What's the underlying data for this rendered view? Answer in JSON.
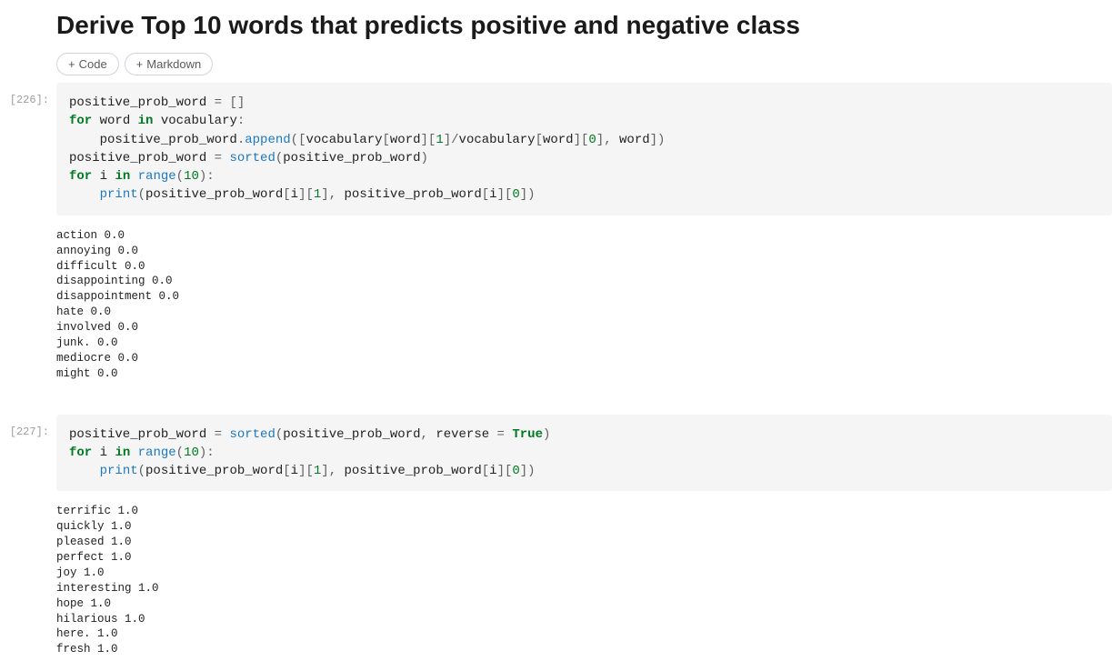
{
  "heading": "Derive Top 10 words that predicts positive and negative class",
  "toolbar": {
    "code_label": "Code",
    "markdown_label": "Markdown"
  },
  "cells": [
    {
      "prompt": "[226]:",
      "code_tokens": [
        [
          "positive_prob_word ",
          ""
        ],
        [
          "= ",
          "op"
        ],
        [
          "[]\n",
          "op"
        ],
        [
          "for",
          "kw"
        ],
        [
          " word ",
          ""
        ],
        [
          "in",
          "kw"
        ],
        [
          " vocabulary",
          ""
        ],
        [
          ":\n",
          "op"
        ],
        [
          "    positive_prob_word",
          ""
        ],
        [
          ".",
          "op"
        ],
        [
          "append",
          "fn"
        ],
        [
          "([",
          "op"
        ],
        [
          "vocabulary",
          ""
        ],
        [
          "[",
          "op"
        ],
        [
          "word",
          ""
        ],
        [
          "][",
          "op"
        ],
        [
          "1",
          "num"
        ],
        [
          "]",
          "op"
        ],
        [
          "/",
          "op"
        ],
        [
          "vocabulary",
          ""
        ],
        [
          "[",
          "op"
        ],
        [
          "word",
          ""
        ],
        [
          "][",
          "op"
        ],
        [
          "0",
          "num"
        ],
        [
          "], ",
          "op"
        ],
        [
          "word",
          ""
        ],
        [
          "])\n",
          "op"
        ],
        [
          "positive_prob_word ",
          ""
        ],
        [
          "= ",
          "op"
        ],
        [
          "sorted",
          "fn"
        ],
        [
          "(",
          "op"
        ],
        [
          "positive_prob_word",
          ""
        ],
        [
          ")\n",
          "op"
        ],
        [
          "for",
          "kw"
        ],
        [
          " i ",
          ""
        ],
        [
          "in",
          "kw"
        ],
        [
          " ",
          ""
        ],
        [
          "range",
          "fn"
        ],
        [
          "(",
          "op"
        ],
        [
          "10",
          "num"
        ],
        [
          "):\n",
          "op"
        ],
        [
          "    ",
          ""
        ],
        [
          "print",
          "fn"
        ],
        [
          "(",
          "op"
        ],
        [
          "positive_prob_word",
          ""
        ],
        [
          "[",
          "op"
        ],
        [
          "i",
          ""
        ],
        [
          "][",
          "op"
        ],
        [
          "1",
          "num"
        ],
        [
          "], ",
          "op"
        ],
        [
          "positive_prob_word",
          ""
        ],
        [
          "[",
          "op"
        ],
        [
          "i",
          ""
        ],
        [
          "][",
          "op"
        ],
        [
          "0",
          "num"
        ],
        [
          "])",
          "op"
        ]
      ],
      "output": "action 0.0\nannoying 0.0\ndifficult 0.0\ndisappointing 0.0\ndisappointment 0.0\nhate 0.0\ninvolved 0.0\njunk. 0.0\nmediocre 0.0\nmight 0.0"
    },
    {
      "prompt": "[227]:",
      "code_tokens": [
        [
          "positive_prob_word ",
          ""
        ],
        [
          "= ",
          "op"
        ],
        [
          "sorted",
          "fn"
        ],
        [
          "(",
          "op"
        ],
        [
          "positive_prob_word",
          ""
        ],
        [
          ", ",
          "op"
        ],
        [
          "reverse ",
          ""
        ],
        [
          "= ",
          "op"
        ],
        [
          "True",
          "bool"
        ],
        [
          ")\n",
          "op"
        ],
        [
          "for",
          "kw"
        ],
        [
          " i ",
          ""
        ],
        [
          "in",
          "kw"
        ],
        [
          " ",
          ""
        ],
        [
          "range",
          "fn"
        ],
        [
          "(",
          "op"
        ],
        [
          "10",
          "num"
        ],
        [
          "):\n",
          "op"
        ],
        [
          "    ",
          ""
        ],
        [
          "print",
          "fn"
        ],
        [
          "(",
          "op"
        ],
        [
          "positive_prob_word",
          ""
        ],
        [
          "[",
          "op"
        ],
        [
          "i",
          ""
        ],
        [
          "][",
          "op"
        ],
        [
          "1",
          "num"
        ],
        [
          "], ",
          "op"
        ],
        [
          "positive_prob_word",
          ""
        ],
        [
          "[",
          "op"
        ],
        [
          "i",
          ""
        ],
        [
          "][",
          "op"
        ],
        [
          "0",
          "num"
        ],
        [
          "])",
          "op"
        ]
      ],
      "output": "terrific 1.0\nquickly 1.0\npleased 1.0\nperfect 1.0\njoy 1.0\ninteresting 1.0\nhope 1.0\nhilarious 1.0\nhere. 1.0\nfresh 1.0"
    }
  ]
}
